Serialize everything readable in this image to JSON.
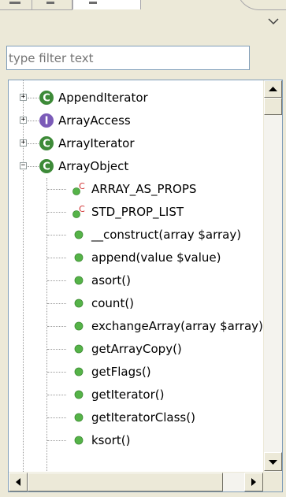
{
  "filter": {
    "placeholder": "type filter text"
  },
  "tree": {
    "items": [
      {
        "label": "AppendIterator",
        "kind": "class",
        "expander": "+"
      },
      {
        "label": "ArrayAccess",
        "kind": "interface",
        "expander": "+"
      },
      {
        "label": "ArrayIterator",
        "kind": "class",
        "expander": "+"
      },
      {
        "label": "ArrayObject",
        "kind": "class",
        "expander": "−"
      },
      {
        "label": "ARRAY_AS_PROPS",
        "kind": "constant"
      },
      {
        "label": "STD_PROP_LIST",
        "kind": "constant"
      },
      {
        "label": "__construct(array $array)",
        "kind": "method"
      },
      {
        "label": "append(value $value)",
        "kind": "method"
      },
      {
        "label": "asort()",
        "kind": "method"
      },
      {
        "label": "count()",
        "kind": "method"
      },
      {
        "label": "exchangeArray(array $array)",
        "kind": "method"
      },
      {
        "label": "getArrayCopy()",
        "kind": "method"
      },
      {
        "label": "getFlags()",
        "kind": "method"
      },
      {
        "label": "getIterator()",
        "kind": "method"
      },
      {
        "label": "getIteratorClass()",
        "kind": "method"
      },
      {
        "label": "ksort()",
        "kind": "method"
      }
    ]
  },
  "icons": {
    "class": "class-icon",
    "interface": "interface-icon",
    "constant": "constant-icon",
    "method": "method-icon",
    "view_menu": "chevron-down-icon",
    "scroll_up": "arrow-up-icon",
    "scroll_down": "arrow-down-icon",
    "scroll_left": "arrow-left-icon",
    "scroll_right": "arrow-right-icon"
  },
  "colors": {
    "class": "#3d8a38",
    "interface": "#7b5bb8",
    "method": "#55b348",
    "constant_letter": "#d03030",
    "border": "#7f9db9",
    "chrome": "#ece9d8"
  }
}
